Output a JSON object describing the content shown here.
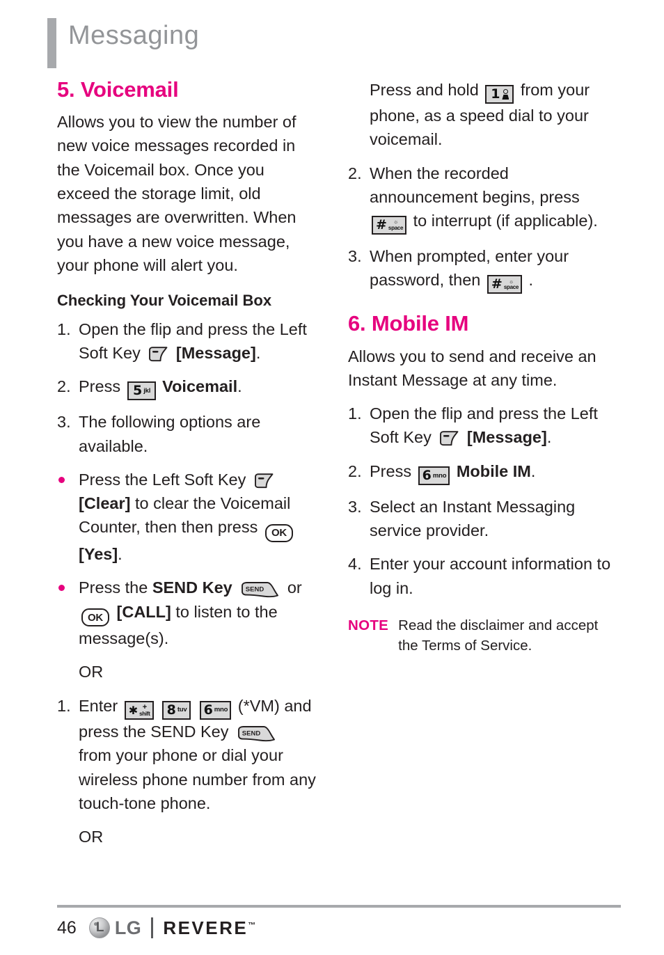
{
  "header": {
    "title": "Messaging"
  },
  "colors": {
    "accent_pink": "#e6007e",
    "header_gray": "#939598",
    "rule_gray": "#a7a9ac",
    "body_text": "#231f20"
  },
  "left_column": {
    "section_heading": "5. Voicemail",
    "intro": "Allows you to view the number of new voice messages recorded in the Voicemail box. Once you exceed the storage limit, old messages are overwritten. When you have a new voice message, your phone will alert you.",
    "subheading": "Checking Your Voicemail Box",
    "steps": [
      {
        "num": "1.",
        "text_before": "Open the flip and press the Left Soft Key",
        "icon": "left-soft-key-icon",
        "text_after": "[Message].",
        "after_bold": "[Message]",
        "after_tail": "."
      },
      {
        "num": "2.",
        "text_before": "Press",
        "icon": "key-5-jkl",
        "key_digit": "5",
        "key_letters": "jkl",
        "after_bold": "Voicemail",
        "after_tail": "."
      },
      {
        "num": "3.",
        "text_before": "The following options are available."
      }
    ],
    "bullets": [
      {
        "part1": "Press the Left Soft Key",
        "icon1": "left-soft-key-icon",
        "bold1": "[Clear]",
        "part2": "to clear the Voicemail Counter, then then press",
        "icon2": "ok-key-icon",
        "icon2_label": "OK",
        "bold2": "[Yes]",
        "tail": "."
      },
      {
        "part1": "Press the",
        "bold1": "SEND Key",
        "icon1": "send-key-icon",
        "icon1_label": "SEND",
        "part2": "or",
        "icon2": "ok-key-icon",
        "icon2_label": "OK",
        "bold2": "[CALL]",
        "part3": "to listen to the message(s)."
      }
    ],
    "or_1": "OR",
    "enter_step": {
      "num": "1.",
      "text_before": "Enter",
      "keys": [
        {
          "digit": "✱",
          "letters": "shift",
          "plus": "+",
          "name": "key-star-shift"
        },
        {
          "digit": "8",
          "letters": "tuv",
          "name": "key-8-tuv"
        },
        {
          "digit": "6",
          "letters": "mno",
          "name": "key-6-mno"
        }
      ],
      "paren": "(*VM)",
      "text_mid": "and press the SEND Key",
      "icon": "send-key-icon",
      "icon_label": "SEND",
      "text_after": "from your phone or dial your wireless phone number from any touch-tone phone."
    },
    "or_2": "OR"
  },
  "right_column": {
    "continued_step": {
      "text_before": "Press and hold",
      "key_digit": "1",
      "key_icon": "key-1-voicemail",
      "text_after": "from your phone, as a speed dial to your voicemail."
    },
    "steps": [
      {
        "num": "2.",
        "text_before": "When the recorded announcement begins, press",
        "key_digit": "#",
        "key_letters": "space",
        "key_icon": "key-hash-space",
        "text_after": "to interrupt (if applicable)."
      },
      {
        "num": "3.",
        "text_before": "When prompted, enter your password, then",
        "key_digit": "#",
        "key_letters": "space",
        "key_icon": "key-hash-space",
        "text_after": "."
      }
    ],
    "section_heading": "6. Mobile IM",
    "intro": "Allows you to send and receive an Instant Message at any time.",
    "im_steps": [
      {
        "num": "1.",
        "text_before": "Open the flip and press the Left Soft Key",
        "icon": "left-soft-key-icon",
        "after_bold": "[Message]",
        "after_tail": "."
      },
      {
        "num": "2.",
        "text_before": "Press",
        "key_digit": "6",
        "key_letters": "mno",
        "key_icon": "key-6-mno",
        "after_bold": "Mobile IM",
        "after_tail": "."
      },
      {
        "num": "3.",
        "text_before": "Select an Instant Messaging service provider."
      },
      {
        "num": "4.",
        "text_before": "Enter your account information to log in."
      }
    ],
    "note": {
      "label": "NOTE",
      "text": "Read the disclaimer and accept the Terms of Service."
    }
  },
  "footer": {
    "page_number": "46",
    "brand": "LG",
    "model": "REVERE",
    "trademark": "™"
  }
}
